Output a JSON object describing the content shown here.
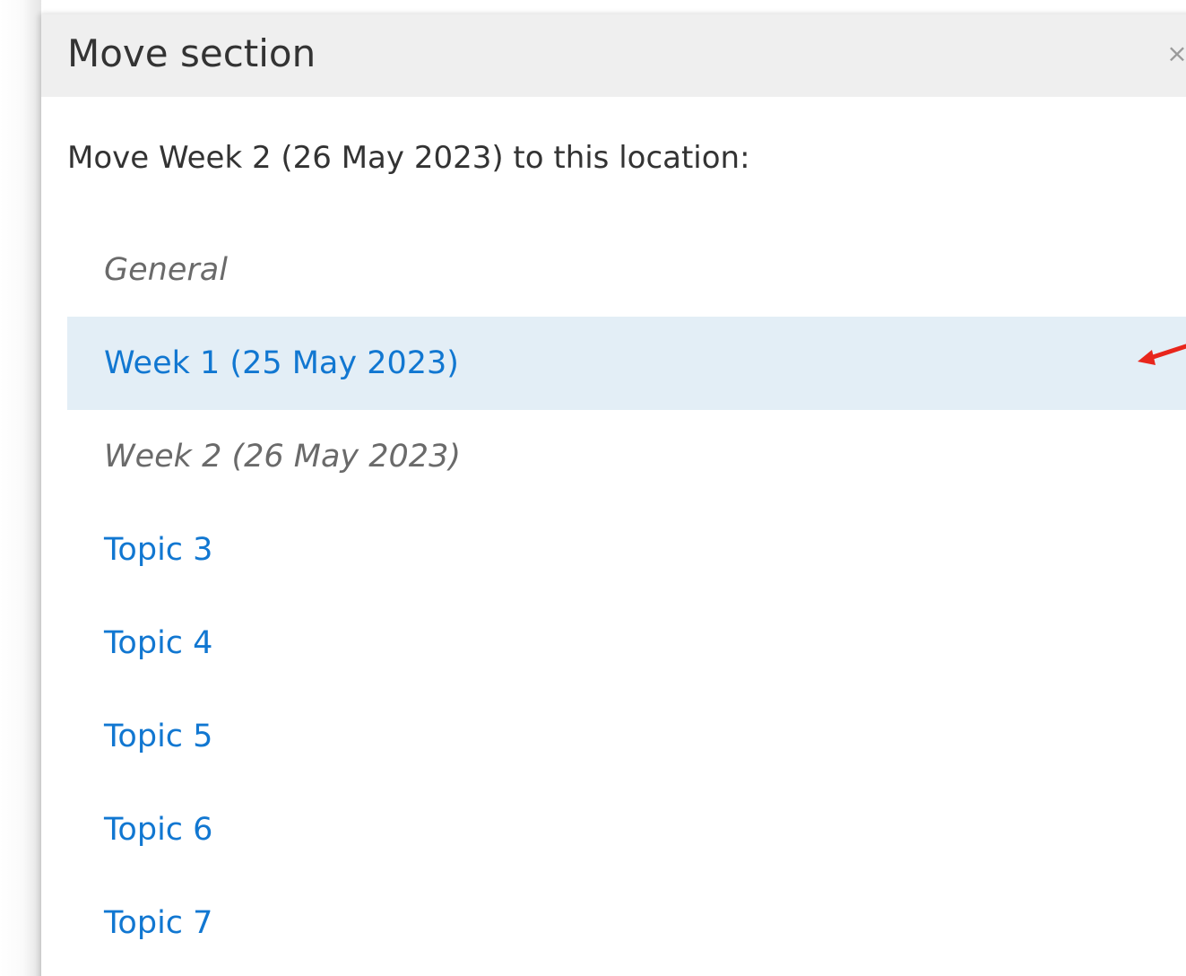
{
  "dialog": {
    "title": "Move section",
    "close_glyph": "×",
    "close_icon": "close-icon",
    "instruction": "Move Week 2 (26 May 2023) to this location:"
  },
  "sections": [
    {
      "label": "General",
      "state": "current-disabled"
    },
    {
      "label": "Week 1 (25 May 2023)",
      "state": "link-highlighted"
    },
    {
      "label": "Week 2 (26 May 2023)",
      "state": "current-disabled"
    },
    {
      "label": "Topic 3",
      "state": "link"
    },
    {
      "label": "Topic 4",
      "state": "link"
    },
    {
      "label": "Topic 5",
      "state": "link"
    },
    {
      "label": "Topic 6",
      "state": "link"
    },
    {
      "label": "Topic 7",
      "state": "link"
    }
  ],
  "colors": {
    "link": "#1177d1",
    "muted": "#6a6a6a",
    "highlight_row": "#e3eef6",
    "header_bg": "#efefef",
    "annotation_arrow": "#e8261c"
  },
  "annotation": {
    "icon": "red-arrow-icon"
  }
}
